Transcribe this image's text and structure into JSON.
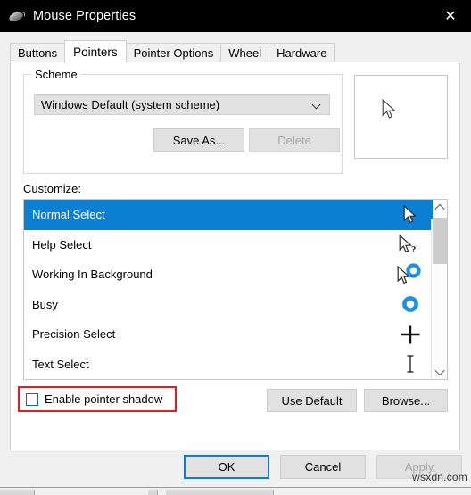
{
  "window": {
    "title": "Mouse Properties",
    "icon": "mouse-icon",
    "close_label": "✕"
  },
  "tabs": [
    {
      "label": "Buttons",
      "active": false
    },
    {
      "label": "Pointers",
      "active": true
    },
    {
      "label": "Pointer Options",
      "active": false
    },
    {
      "label": "Wheel",
      "active": false
    },
    {
      "label": "Hardware",
      "active": false
    }
  ],
  "scheme": {
    "legend": "Scheme",
    "selected": "Windows Default (system scheme)",
    "save_as_label": "Save As...",
    "delete_label": "Delete",
    "delete_enabled": false
  },
  "preview": {
    "cursor": "arrow-cursor"
  },
  "customize": {
    "label": "Customize:",
    "items": [
      {
        "label": "Normal Select",
        "icon": "arrow-cursor",
        "selected": true
      },
      {
        "label": "Help Select",
        "icon": "arrow-question-cursor",
        "selected": false
      },
      {
        "label": "Working In Background",
        "icon": "arrow-busy-cursor",
        "selected": false
      },
      {
        "label": "Busy",
        "icon": "busy-ring-cursor",
        "selected": false
      },
      {
        "label": "Precision Select",
        "icon": "crosshair-cursor",
        "selected": false
      },
      {
        "label": "Text Select",
        "icon": "ibeam-cursor",
        "selected": false
      }
    ]
  },
  "shadow": {
    "label": "Enable pointer shadow",
    "checked": false,
    "highlighted": true
  },
  "actions": {
    "use_default_label": "Use Default",
    "browse_label": "Browse..."
  },
  "dialog_buttons": {
    "ok_label": "OK",
    "cancel_label": "Cancel",
    "apply_label": "Apply",
    "apply_enabled": false
  },
  "watermark": "wsxdn.com",
  "colors": {
    "accent_blue": "#0a7fd4",
    "titlebar": "#000000",
    "dialog_bg": "#f0f0f0",
    "page_bg": "#ffffff",
    "button_bg": "#e1e1e1",
    "highlight_red": "#e02020",
    "checkbox_border": "#1f6f7a",
    "disabled_text": "#a6a6a6"
  }
}
